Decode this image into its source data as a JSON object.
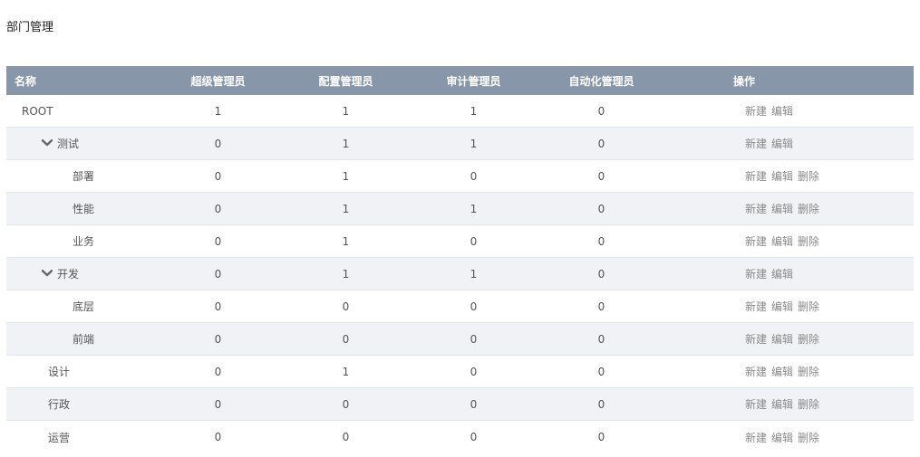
{
  "page": {
    "title": "部门管理"
  },
  "table": {
    "headers": [
      "名称",
      "超级管理员",
      "配置管理员",
      "审计管理员",
      "自动化管理员",
      "操作"
    ],
    "rows": [
      {
        "name": "ROOT",
        "level": 0,
        "expandable": false,
        "super": "1",
        "config": "1",
        "audit": "1",
        "auto": "0",
        "ops": [
          "新建",
          "编辑"
        ]
      },
      {
        "name": "测试",
        "level": 1,
        "expandable": true,
        "super": "0",
        "config": "1",
        "audit": "1",
        "auto": "0",
        "ops": [
          "新建",
          "编辑"
        ]
      },
      {
        "name": "部署",
        "level": 2,
        "expandable": false,
        "super": "0",
        "config": "1",
        "audit": "0",
        "auto": "0",
        "ops": [
          "新建",
          "编辑",
          "删除"
        ]
      },
      {
        "name": "性能",
        "level": 2,
        "expandable": false,
        "super": "0",
        "config": "1",
        "audit": "1",
        "auto": "0",
        "ops": [
          "新建",
          "编辑",
          "删除"
        ]
      },
      {
        "name": "业务",
        "level": 2,
        "expandable": false,
        "super": "0",
        "config": "1",
        "audit": "0",
        "auto": "0",
        "ops": [
          "新建",
          "编辑",
          "删除"
        ]
      },
      {
        "name": "开发",
        "level": 1,
        "expandable": true,
        "super": "0",
        "config": "1",
        "audit": "1",
        "auto": "0",
        "ops": [
          "新建",
          "编辑"
        ]
      },
      {
        "name": "底层",
        "level": 2,
        "expandable": false,
        "super": "0",
        "config": "0",
        "audit": "0",
        "auto": "0",
        "ops": [
          "新建",
          "编辑",
          "删除"
        ]
      },
      {
        "name": "前端",
        "level": 2,
        "expandable": false,
        "super": "0",
        "config": "0",
        "audit": "0",
        "auto": "0",
        "ops": [
          "新建",
          "编辑",
          "删除"
        ]
      },
      {
        "name": "设计",
        "level": 1,
        "expandable": false,
        "super": "0",
        "config": "1",
        "audit": "0",
        "auto": "0",
        "ops": [
          "新建",
          "编辑",
          "删除"
        ]
      },
      {
        "name": "行政",
        "level": 1,
        "expandable": false,
        "super": "0",
        "config": "0",
        "audit": "0",
        "auto": "0",
        "ops": [
          "新建",
          "编辑",
          "删除"
        ]
      },
      {
        "name": "运营",
        "level": 1,
        "expandable": false,
        "super": "0",
        "config": "0",
        "audit": "0",
        "auto": "0",
        "ops": [
          "新建",
          "编辑",
          "删除"
        ]
      }
    ]
  },
  "colors": {
    "header_bg": "#8796a8",
    "alt_row_bg": "#f0f2f5",
    "op_text": "#8a8a8a"
  },
  "icons": {
    "expand": "chevron-down-icon"
  }
}
